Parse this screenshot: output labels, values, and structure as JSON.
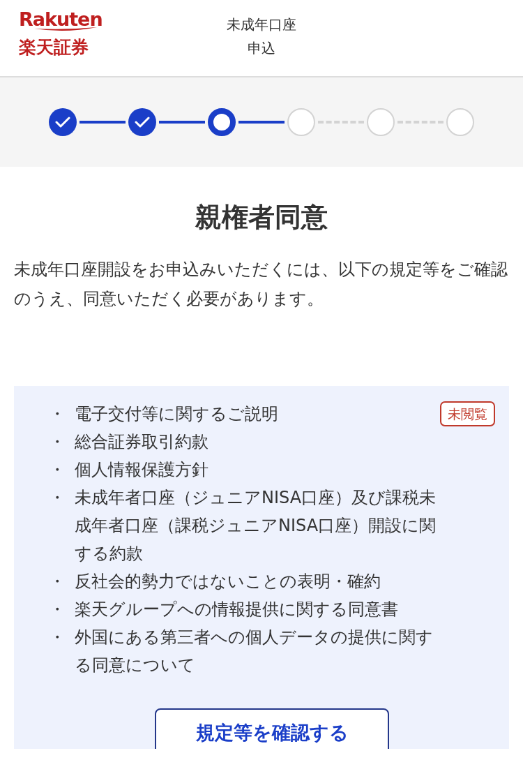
{
  "header": {
    "logo_top": "Rakuten",
    "logo_bottom": "楽天証券",
    "title": "未成年口座",
    "subtitle": "申込"
  },
  "steps": [
    {
      "completed": true,
      "selected": false
    },
    {
      "completed": true,
      "selected": false
    },
    {
      "completed": false,
      "selected": true
    },
    {
      "completed": false,
      "selected": false
    },
    {
      "completed": false,
      "selected": false
    },
    {
      "completed": false,
      "selected": false
    }
  ],
  "heading": "親権者同意",
  "intro": "未成年口座開設をお申込みいただくには、以下の規定等をご確認のうえ、同意いただく必要があります。",
  "documents": {
    "badge": "未閲覧",
    "items": [
      {
        "bullet": "・",
        "text": "電子交付等に関するご説明"
      },
      {
        "bullet": "・",
        "text": "総合証券取引約款"
      },
      {
        "bullet": "・",
        "text": "個人情報保護方針"
      },
      {
        "bullet": "・",
        "text": "未成年者口座（ジュニアNISA口座）及び課税未成年者口座（課税ジュニアNISA口座）開設に関する約款"
      },
      {
        "bullet": "・",
        "text": "反社会的勢力ではないことの表明・確約"
      },
      {
        "bullet": "・",
        "text": "楽天グループへの情報提供に関する同意書"
      },
      {
        "bullet": "・",
        "text": "外国にある第三者への個人データの提供に関する同意について"
      }
    ],
    "button": "規定等を確認する"
  }
}
